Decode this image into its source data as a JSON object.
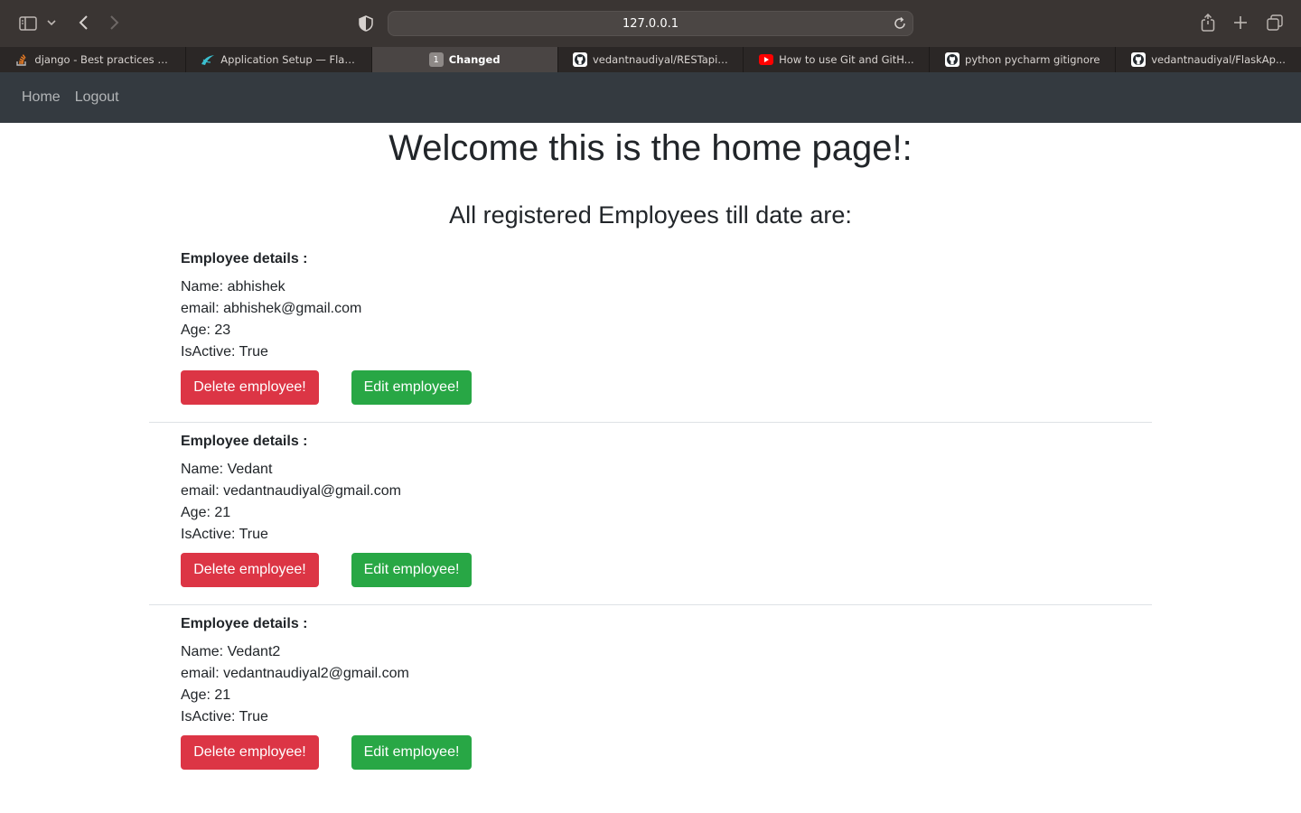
{
  "browser": {
    "url": "127.0.0.1",
    "tabs": [
      {
        "label": "django - Best practices f...",
        "favicon": "stackoverflow-icon",
        "active": false
      },
      {
        "label": "Application Setup — Flas...",
        "favicon": "flask-icon",
        "active": false
      },
      {
        "label": "Changed",
        "favicon": "tab-count-badge",
        "badge": "1",
        "active": true
      },
      {
        "label": "vedantnaudiyal/RESTapis...",
        "favicon": "github-icon",
        "active": false
      },
      {
        "label": "How to use Git and GitH...",
        "favicon": "youtube-icon",
        "active": false
      },
      {
        "label": "python pycharm gitignore",
        "favicon": "github-icon",
        "active": false
      },
      {
        "label": "vedantnaudiyal/FlaskAp...",
        "favicon": "github-icon",
        "active": false
      }
    ]
  },
  "navbar": {
    "home": "Home",
    "logout": "Logout"
  },
  "page": {
    "title": "Welcome this is the home page!:",
    "subtitle": "All registered Employees till date are:"
  },
  "employees": [
    {
      "header": "Employee details :",
      "name": "Name: abhishek",
      "email": "email: abhishek@gmail.com",
      "age": "Age: 23",
      "active": "IsActive: True",
      "delete_label": "Delete employee!",
      "edit_label": "Edit employee!"
    },
    {
      "header": "Employee details :",
      "name": "Name: Vedant",
      "email": "email: vedantnaudiyal@gmail.com",
      "age": "Age: 21",
      "active": "IsActive: True",
      "delete_label": "Delete employee!",
      "edit_label": "Edit employee!"
    },
    {
      "header": "Employee details :",
      "name": "Name: Vedant2",
      "email": "email: vedantnaudiyal2@gmail.com",
      "age": "Age: 21",
      "active": "IsActive: True",
      "delete_label": "Delete employee!",
      "edit_label": "Edit employee!"
    }
  ],
  "colors": {
    "navbar": "#343a40",
    "danger": "#dc3545",
    "success": "#28a745"
  }
}
